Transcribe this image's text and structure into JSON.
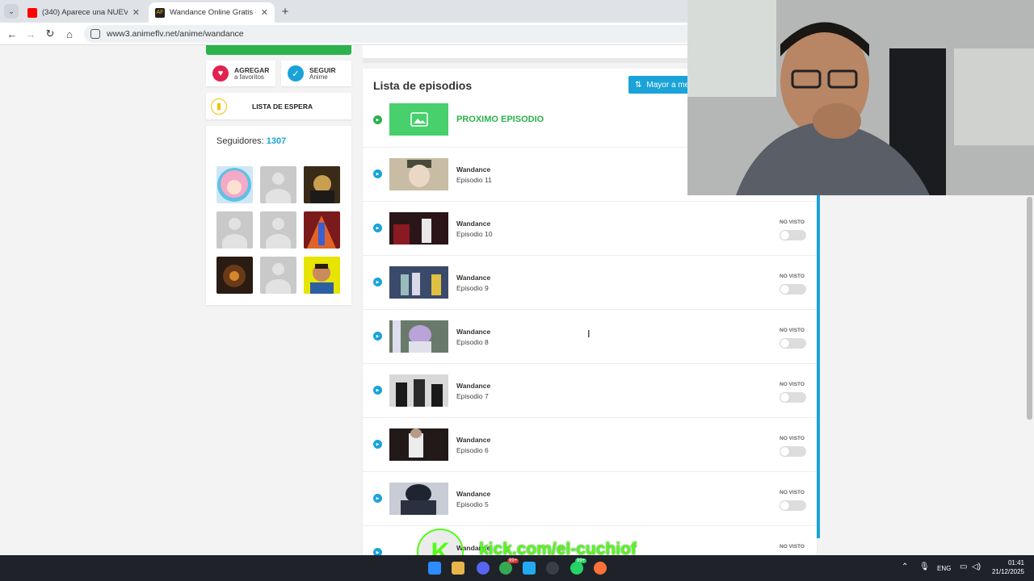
{
  "browser": {
    "tabs": [
      {
        "title": "(340) Aparece una NUEVA CON",
        "active": false,
        "favicon": "youtube-icon"
      },
      {
        "title": "Wandance Online Gratis - Anim",
        "active": true,
        "favicon": "animeflv-icon"
      }
    ],
    "url": "www3.animeflv.net/anime/wandance"
  },
  "sidebar": {
    "add_fav": {
      "line1": "AGREGAR",
      "line2": "a favoritos"
    },
    "follow": {
      "line1": "SEGUIR",
      "line2": "Anime"
    },
    "waitlist": "LISTA DE ESPERA",
    "followers_label": "Seguidores:",
    "followers_count": "1307"
  },
  "episodes": {
    "title": "Lista de episodios",
    "sort_label": "Mayor a me",
    "next_label": "PROXIMO EPISODIO",
    "items": [
      {
        "name": "Wandance",
        "num": "Episodio 11",
        "status": ""
      },
      {
        "name": "Wandance",
        "num": "Episodio 10",
        "status": "NO VISTO"
      },
      {
        "name": "Wandance",
        "num": "Episodio 9",
        "status": "NO VISTO"
      },
      {
        "name": "Wandance",
        "num": "Episodio 8",
        "status": "NO VISTO"
      },
      {
        "name": "Wandance",
        "num": "Episodio 7",
        "status": "NO VISTO"
      },
      {
        "name": "Wandance",
        "num": "Episodio 6",
        "status": "NO VISTO"
      },
      {
        "name": "Wandance",
        "num": "Episodio 5",
        "status": "NO VISTO"
      },
      {
        "name": "Wandance",
        "num": "",
        "status": "NO VISTO"
      }
    ]
  },
  "overlay": {
    "watermark_logo": "K",
    "watermark": "kick.com/el-cuchiof"
  },
  "taskbar": {
    "lang": "ENG",
    "time": "01:41",
    "date": "21/12/2025",
    "badge_chrome": "99+",
    "badge_whatsapp": "99+"
  },
  "colors": {
    "accent": "#1aa3d9",
    "green": "#2bb24c",
    "fav": "#e0234e",
    "kick": "#53fc18"
  }
}
